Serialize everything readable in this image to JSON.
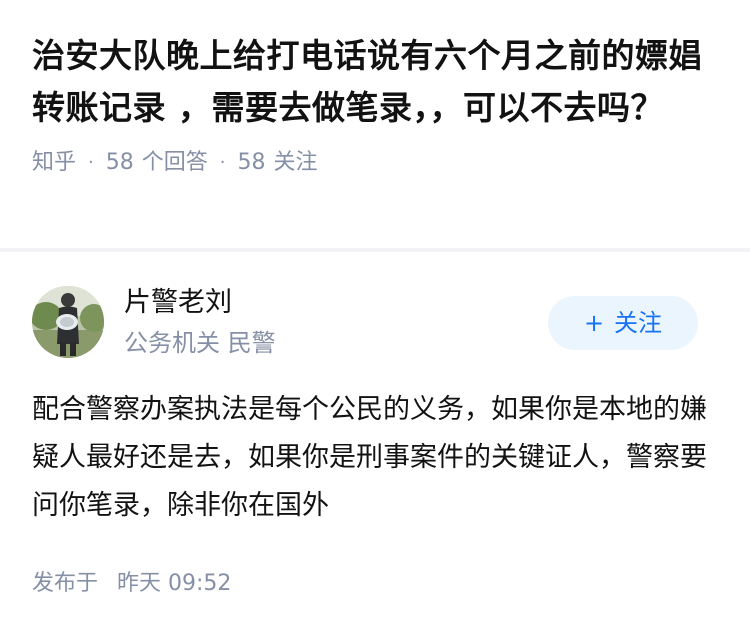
{
  "question": {
    "title": "治安大队晚上给打电话说有六个月之前的嫖娼转账记录 ，需要去做笔录，，可以不去吗？",
    "source": "知乎",
    "answers_count": "58",
    "answers_label": "个回答",
    "followers_count": "58",
    "followers_label": "关注"
  },
  "author": {
    "name": "片警老刘",
    "description": "公务机关 民警",
    "follow_button": {
      "icon": "plus-icon",
      "label": "关注"
    }
  },
  "answer": {
    "text": "配合警察办案执法是每个公民的义务，如果你是本地的嫌疑人最好还是去，如果你是刑事案件的关键证人，警察要问你笔录，除非你在国外"
  },
  "footer": {
    "published_label": "发布于",
    "published_time": "昨天 09:52"
  },
  "colors": {
    "title": "#121212",
    "meta": "#8590a6",
    "accent": "#1772f6",
    "follow_bg": "#ebf5fd"
  }
}
